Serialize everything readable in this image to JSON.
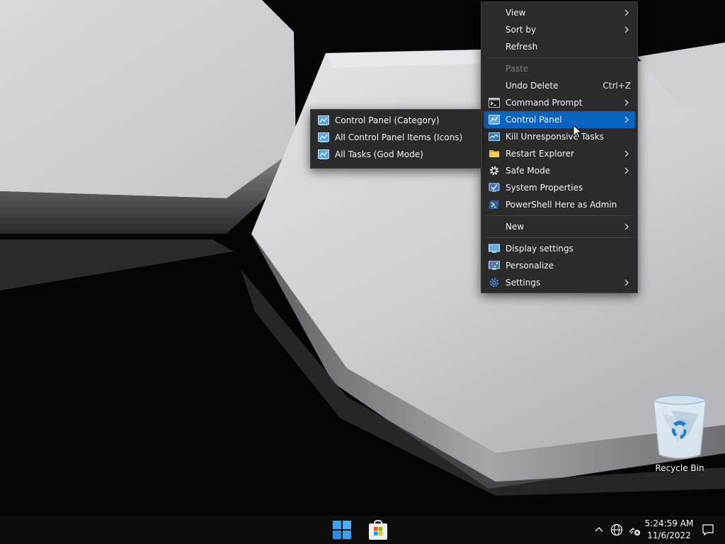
{
  "context_menu": {
    "items": [
      {
        "label": "View",
        "has_submenu": true,
        "icon": ""
      },
      {
        "label": "Sort by",
        "has_submenu": true,
        "icon": ""
      },
      {
        "label": "Refresh",
        "icon": ""
      },
      {
        "separator": true
      },
      {
        "label": "Paste",
        "disabled": true,
        "icon": ""
      },
      {
        "label": "Undo Delete",
        "shortcut": "Ctrl+Z",
        "icon": ""
      },
      {
        "label": "Command Prompt",
        "has_submenu": true,
        "icon": "command-prompt-icon"
      },
      {
        "label": "Control Panel",
        "has_submenu": true,
        "active": true,
        "icon": "control-panel-icon"
      },
      {
        "label": "Kill Unresponsive Tasks",
        "icon": "task-manager-icon"
      },
      {
        "label": "Restart Explorer",
        "has_submenu": true,
        "icon": "folder-icon"
      },
      {
        "label": "Safe Mode",
        "has_submenu": true,
        "icon": "gear-icon"
      },
      {
        "label": "System Properties",
        "icon": "system-properties-icon"
      },
      {
        "label": "PowerShell Here as Admin",
        "icon": "powershell-icon"
      },
      {
        "separator": true
      },
      {
        "label": "New",
        "has_submenu": true,
        "icon": ""
      },
      {
        "separator": true
      },
      {
        "label": "Display settings",
        "icon": "display-icon"
      },
      {
        "label": "Personalize",
        "icon": "personalize-icon"
      },
      {
        "label": "Settings",
        "has_submenu": true,
        "icon": "settings-gear-icon"
      }
    ]
  },
  "submenu": {
    "items": [
      {
        "label": "Control Panel (Category)",
        "icon": "control-panel-icon"
      },
      {
        "label": "All Control Panel Items (Icons)",
        "icon": "control-panel-icon"
      },
      {
        "label": "All Tasks (God Mode)",
        "icon": "control-panel-icon"
      }
    ]
  },
  "desktop": {
    "recycle_bin_label": "Recycle Bin"
  },
  "taskbar": {
    "start_icon": "windows-start-icon",
    "pinned": [
      "microsoft-store-icon"
    ],
    "tray": [
      "chevron-up-icon",
      "language-globe-icon",
      "network-disconnected-icon",
      "notification-icon"
    ],
    "clock_time": "5:24:59 AM",
    "clock_date": "11/6/2022"
  },
  "colors": {
    "menu_background": "#2b2b2b",
    "menu_highlight": "#0a64c2",
    "taskbar_background": "#0d0d0d"
  }
}
